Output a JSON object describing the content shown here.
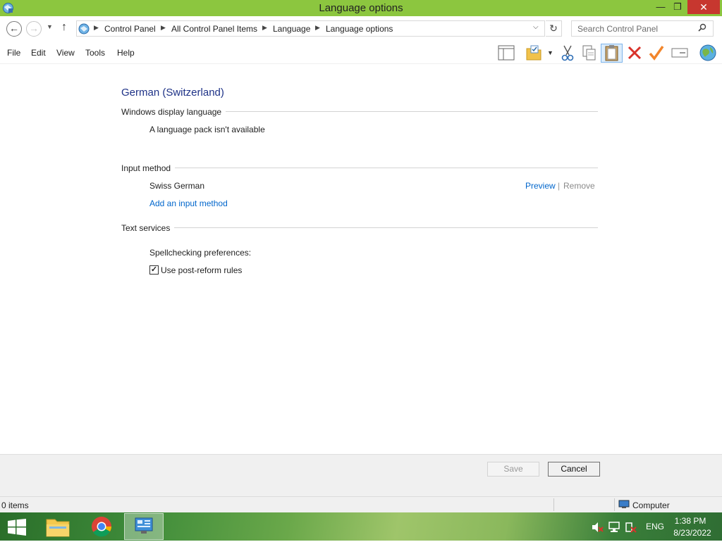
{
  "window": {
    "title": "Language options",
    "minimize_glyph": "—",
    "maximize_glyph": "❐",
    "close_glyph": "✕"
  },
  "nav": {
    "breadcrumbs": [
      "Control Panel",
      "All Control Panel Items",
      "Language",
      "Language options"
    ],
    "search_placeholder": "Search Control Panel"
  },
  "menu": {
    "items": [
      "File",
      "Edit",
      "View",
      "Tools",
      "Help"
    ]
  },
  "toolbar": {
    "icons": [
      "layout-pane-icon",
      "properties-icon",
      "cut-icon",
      "copy-icon",
      "paste-icon",
      "delete-icon",
      "check-icon",
      "rename-icon",
      "globe-icon"
    ]
  },
  "content": {
    "heading": "German (Switzerland)",
    "display_language": {
      "title": "Windows display language",
      "message": "A language pack isn't available"
    },
    "input_method": {
      "title": "Input method",
      "method_name": "Swiss German",
      "preview_label": "Preview",
      "separator": "|",
      "remove_label": "Remove",
      "add_label": "Add an input method"
    },
    "text_services": {
      "title": "Text services",
      "spellcheck_label": "Spellchecking preferences:",
      "post_reform_label": "Use post-reform rules",
      "post_reform_checked": true
    }
  },
  "buttons": {
    "save": "Save",
    "cancel": "Cancel"
  },
  "statusbar": {
    "items_count": "0 items",
    "location": "Computer"
  },
  "taskbar": {
    "language": "ENG",
    "time": "1:38 PM",
    "date": "8/23/2022"
  },
  "colors": {
    "titlebar": "#8cc63f",
    "close_button": "#c7372f",
    "heading": "#1e3287",
    "link": "#0066cc"
  }
}
